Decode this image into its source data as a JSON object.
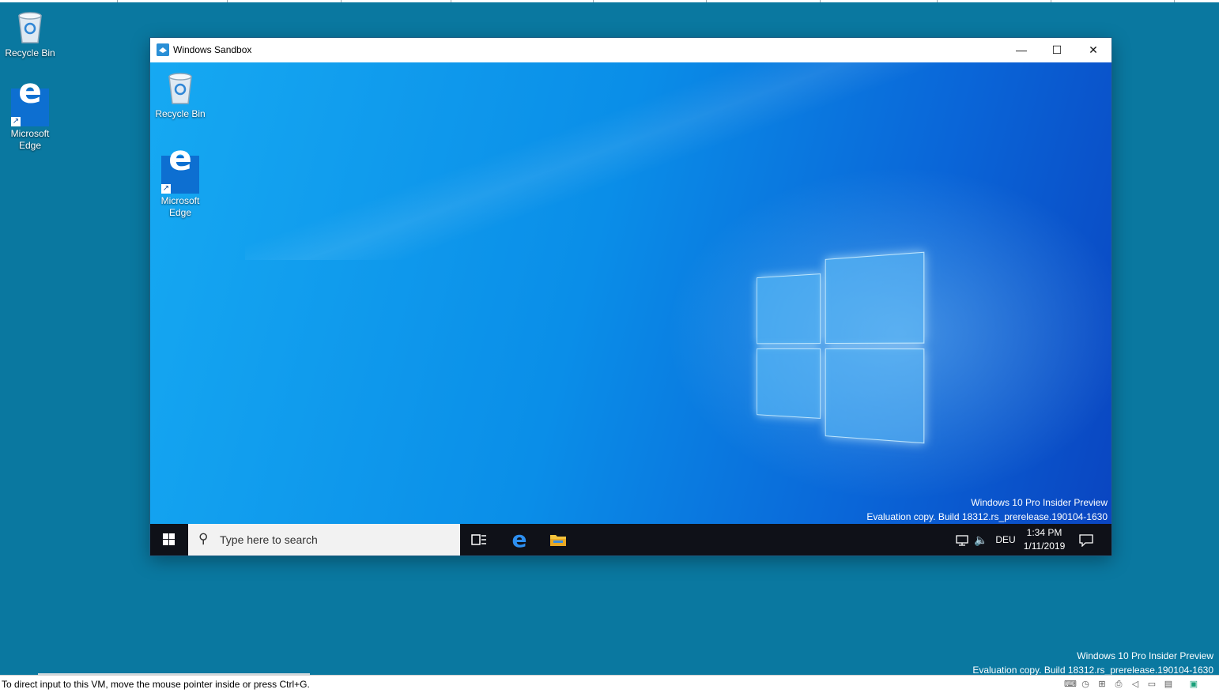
{
  "host_desktop": {
    "icons": [
      {
        "label": "Recycle Bin",
        "icon": "recycle-bin-icon"
      },
      {
        "label": "Microsoft\nEdge",
        "icon": "edge-icon"
      }
    ],
    "watermark_line1": "Windows 10 Pro Insider Preview",
    "watermark_line2": "Evaluation copy. Build 18312.rs_prerelease.190104-1630"
  },
  "window": {
    "title": "Windows Sandbox",
    "minimize": "—",
    "maximize": "☐",
    "close": "✕"
  },
  "guest_desktop": {
    "icons": [
      {
        "label": "Recycle Bin",
        "icon": "recycle-bin-icon"
      },
      {
        "label": "Microsoft\nEdge",
        "icon": "edge-icon"
      }
    ],
    "watermark_line1": "Windows 10 Pro Insider Preview",
    "watermark_line2": "Evaluation copy. Build 18312.rs_prerelease.190104-1630"
  },
  "taskbar": {
    "search_placeholder": "Type here to search",
    "language": "DEU",
    "time": "1:34 PM",
    "date": "1/11/2019"
  },
  "status_bar": {
    "message": "To direct input to this VM, move the mouse pointer inside or press Ctrl+G."
  },
  "colors": {
    "host_bg": "#0a78a0",
    "taskbar": "#0f1118",
    "edge_blue": "#0d6fd1"
  }
}
